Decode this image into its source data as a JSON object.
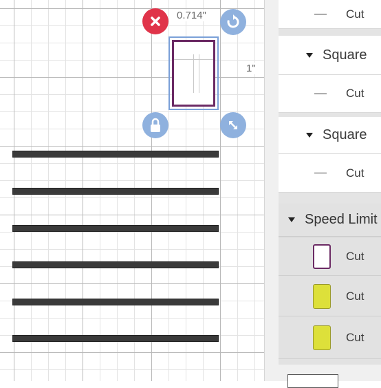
{
  "canvas": {
    "width_label": "0.714\"",
    "height_label": "1\"",
    "bar_count": 6
  },
  "layers_top": [
    {
      "type": "layer",
      "label": "Cut"
    },
    {
      "type": "group",
      "label": "Square"
    },
    {
      "type": "layer",
      "label": "Cut"
    },
    {
      "type": "group",
      "label": "Square"
    },
    {
      "type": "layer",
      "label": "Cut"
    }
  ],
  "speed_limit": {
    "label": "Speed Limit",
    "items": [
      {
        "label": "Cut",
        "swatch": "outline",
        "color": "#6b2a64"
      },
      {
        "label": "Cut",
        "swatch": "fill",
        "color": "#dde03a"
      },
      {
        "label": "Cut",
        "swatch": "fill",
        "color": "#dde03a"
      }
    ]
  },
  "colors": {
    "delete": "#e0344a",
    "handle": "#8fb1de",
    "shape_outline": "#6b2a64",
    "yellow": "#dde03a"
  },
  "icons": [
    "close-icon",
    "rotate-icon",
    "lock-icon",
    "resize-icon",
    "caret-down-icon",
    "dash-icon"
  ]
}
